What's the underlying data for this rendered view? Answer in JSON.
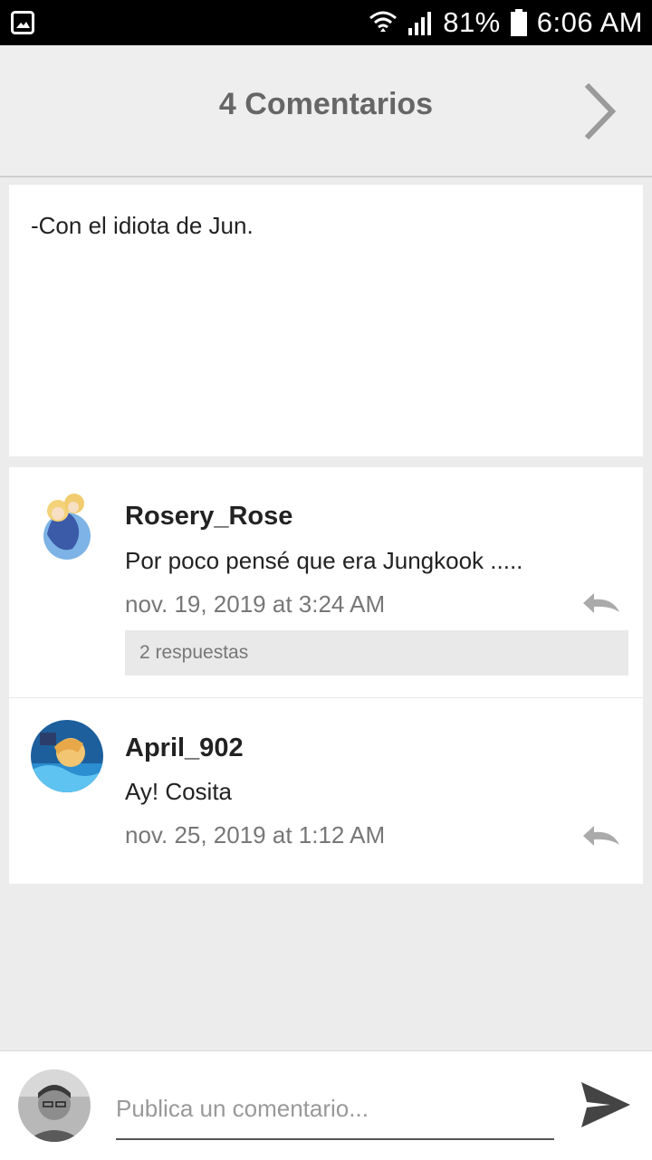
{
  "status_bar": {
    "battery": "81%",
    "time": "6:06 AM"
  },
  "header": {
    "title": "4 Comentarios",
    "next_icon": "chevron-right-icon"
  },
  "post": {
    "text": "-Con el idiota de Jun."
  },
  "comments": [
    {
      "username": "Rosery_Rose",
      "text": "Por poco pensé que era Jungkook .....",
      "time": "nov. 19, 2019 at 3:24 AM",
      "replies": "2 respuestas"
    },
    {
      "username": "April_902",
      "text": "Ay! Cosita",
      "time": "nov. 25, 2019 at 1:12 AM"
    }
  ],
  "composer": {
    "placeholder": "Publica un comentario..."
  },
  "colors": {
    "background": "#ececec",
    "header_title": "#666666",
    "muted_text": "#777777",
    "replies_bg": "#e9e9e9"
  }
}
